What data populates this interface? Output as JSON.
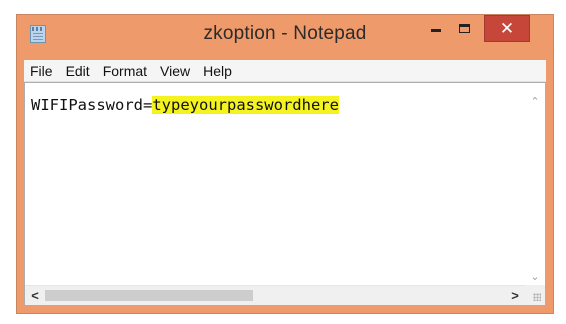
{
  "window": {
    "title": "zkoption - Notepad",
    "icons": {
      "app": "notepad-icon",
      "minimize": "minimize-icon",
      "maximize": "maximize-icon",
      "close": "close-icon"
    },
    "close_symbol": "✕"
  },
  "menu": {
    "items": [
      "File",
      "Edit",
      "Format",
      "View",
      "Help"
    ]
  },
  "editor": {
    "text_prefix": "WIFIPassword=",
    "text_highlighted": "typeyourpasswordhere",
    "highlight_color": "#f4f31f"
  },
  "colors": {
    "frame": "#ef9a6a",
    "close_button": "#c7463a"
  }
}
